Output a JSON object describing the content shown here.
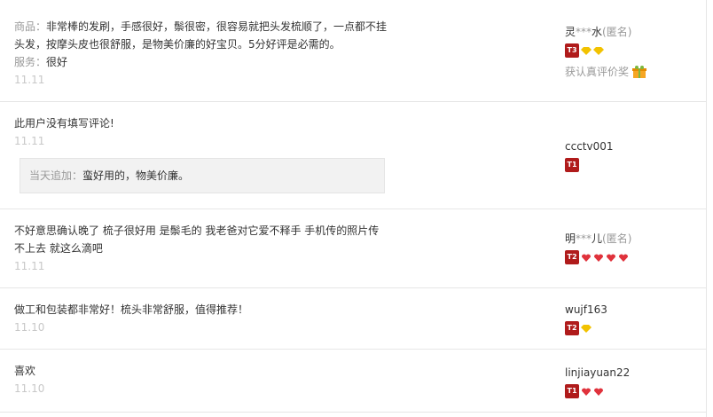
{
  "reviews": [
    {
      "lines": [
        "非常棒的发刷，手感很好，鬃很密，很容易就把头发梳顺了，一点都不挂",
        "头发，按摩头皮也很舒服，是物美价廉的好宝贝。5分好评是必需的。"
      ],
      "product_label": "商品：",
      "service_label": "服务：",
      "service_text": "很好",
      "date": "11.11",
      "user": {
        "name_prefix": "灵",
        "name_mask": "***",
        "name_suffix": "水",
        "anon": "(匿名)",
        "level": "T3",
        "gem_type": "diamond",
        "gem_count": 2,
        "award_text": "获认真评价奖"
      }
    },
    {
      "text": "此用户没有填写评论!",
      "date": "11.11",
      "append_label": "当天追加：",
      "append_text": "蛮好用的，物美价廉。",
      "user": {
        "name": "ccctv001",
        "level": "T1"
      }
    },
    {
      "lines": [
        "不好意思确认晚了 梳子很好用 是鬃毛的 我老爸对它爱不释手 手机传的照片传",
        "不上去 就这么滴吧"
      ],
      "date": "11.11",
      "user": {
        "name_prefix": "明",
        "name_mask": "***",
        "name_suffix": "儿",
        "anon": "(匿名)",
        "level": "T2",
        "gem_type": "heart",
        "gem_count": 4
      }
    },
    {
      "text": "做工和包装都非常好！梳头非常舒服，值得推荐！",
      "date": "11.10",
      "user": {
        "name": "wujf163",
        "level": "T2",
        "gem_type": "diamond",
        "gem_count": 1
      }
    },
    {
      "text": "喜欢",
      "date": "11.10",
      "user": {
        "name": "linjiayuan22",
        "level": "T1",
        "gem_type": "heart",
        "gem_count": 2
      }
    }
  ],
  "colors": {
    "level_badge": "#b01b1b",
    "diamond": "#f2c200",
    "heart": "#e0323c",
    "muted_text": "#999999",
    "date_text": "#c8c8c8"
  }
}
